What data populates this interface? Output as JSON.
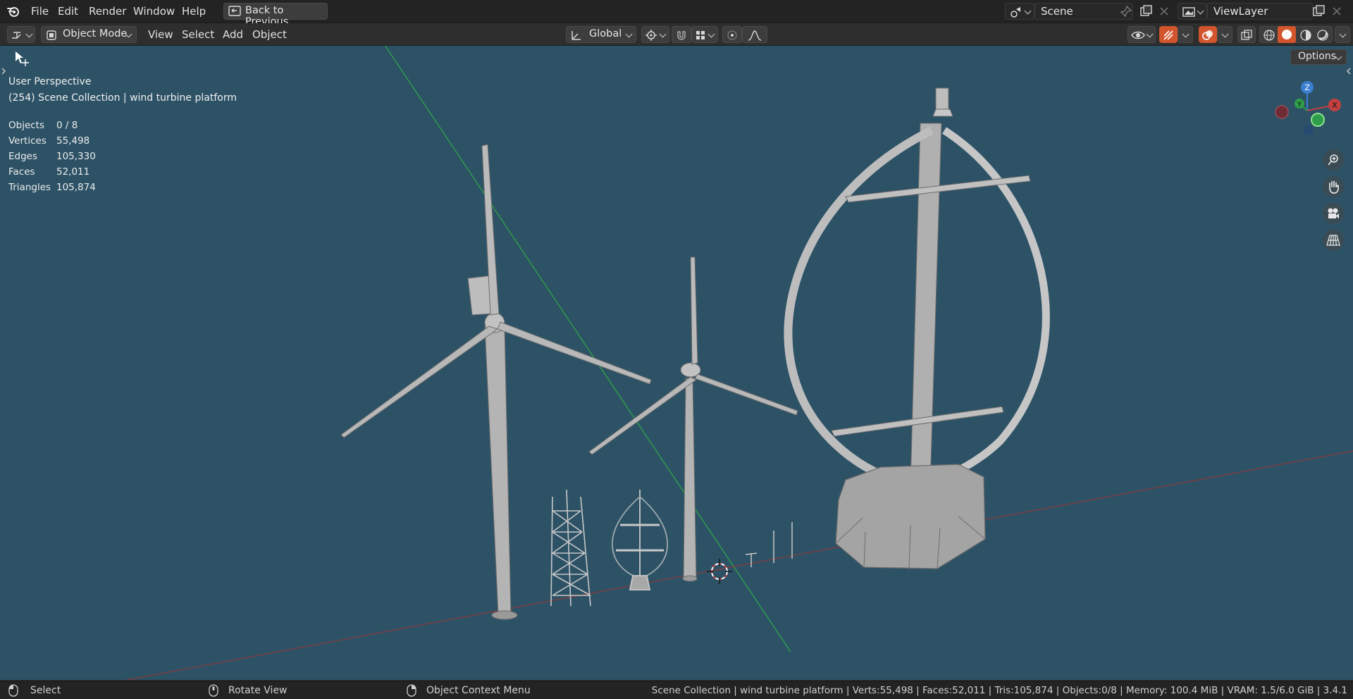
{
  "topbar": {
    "menus": [
      "File",
      "Edit",
      "Render",
      "Window",
      "Help"
    ],
    "back_button": "Back to Previous",
    "scene_name": "Scene",
    "view_layer_name": "ViewLayer"
  },
  "header": {
    "mode": "Object Mode",
    "menus": [
      "View",
      "Select",
      "Add",
      "Object"
    ],
    "transform_orientation": "Global",
    "options": "Options"
  },
  "viewport": {
    "perspective": "User Perspective",
    "collection": "(254) Scene Collection | wind turbine platform",
    "stats": [
      {
        "label": "Objects",
        "value": "0 / 8"
      },
      {
        "label": "Vertices",
        "value": "55,498"
      },
      {
        "label": "Edges",
        "value": "105,330"
      },
      {
        "label": "Faces",
        "value": "52,011"
      },
      {
        "label": "Triangles",
        "value": "105,874"
      }
    ],
    "gizmo": {
      "z": "Z",
      "y": "Y",
      "x": "X"
    }
  },
  "statusbar": {
    "select": "Select",
    "rotate": "Rotate View",
    "context": "Object Context Menu",
    "info": "Scene Collection | wind turbine platform | Verts:55,498 | Faces:52,011 | Tris:105,874 | Objects:0/8 | Memory: 100.4 MiB | VRAM: 1.5/6.0 GiB | 3.4.1"
  },
  "colors": {
    "viewport_bg": "#2d5266",
    "accent": "#d2552e",
    "axis_x": "#c24040",
    "axis_y": "#2e9e4a",
    "axis_z": "#3a7fd0"
  }
}
